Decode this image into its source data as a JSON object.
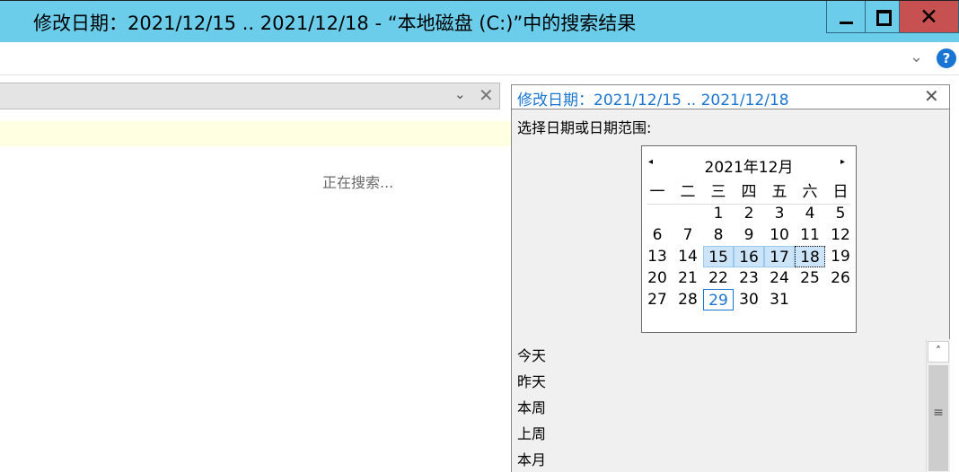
{
  "window": {
    "title": "修改日期：2021/12/15 .. 2021/12/18 - “本地磁盘 (C:)”中的搜索结果",
    "minimize_glyph": "",
    "close_glyph": "✕"
  },
  "ribbon": {
    "expand_glyph": "⌄",
    "help_glyph": "?"
  },
  "address": {
    "dropdown_glyph": "⌄",
    "clear_glyph": "✕"
  },
  "search": {
    "value": "修改日期：2021/12/15 .. 2021/12/18",
    "clear_glyph": "✕"
  },
  "status": {
    "searching": "正在搜索..."
  },
  "date_panel": {
    "prompt": "选择日期或日期范围:",
    "calendar": {
      "prev_glyph": "◂",
      "next_glyph": "▸",
      "month_title": "2021年12月",
      "weekdays": [
        "一",
        "二",
        "三",
        "四",
        "五",
        "六",
        "日"
      ],
      "weeks": [
        [
          "",
          "",
          "1",
          "2",
          "3",
          "4",
          "5"
        ],
        [
          "6",
          "7",
          "8",
          "9",
          "10",
          "11",
          "12"
        ],
        [
          "13",
          "14",
          "15",
          "16",
          "17",
          "18",
          "19"
        ],
        [
          "20",
          "21",
          "22",
          "23",
          "24",
          "25",
          "26"
        ],
        [
          "27",
          "28",
          "29",
          "30",
          "31",
          "",
          ""
        ]
      ]
    },
    "presets": [
      "今天",
      "昨天",
      "本周",
      "上周",
      "本月"
    ],
    "scroll_up_glyph": "˄",
    "scroll_grip_glyph": "≡"
  },
  "colors": {
    "title_bar": "#6bcdea",
    "close_button": "#c75050",
    "accent": "#1a74d2",
    "info_bar": "#ffffe1"
  }
}
